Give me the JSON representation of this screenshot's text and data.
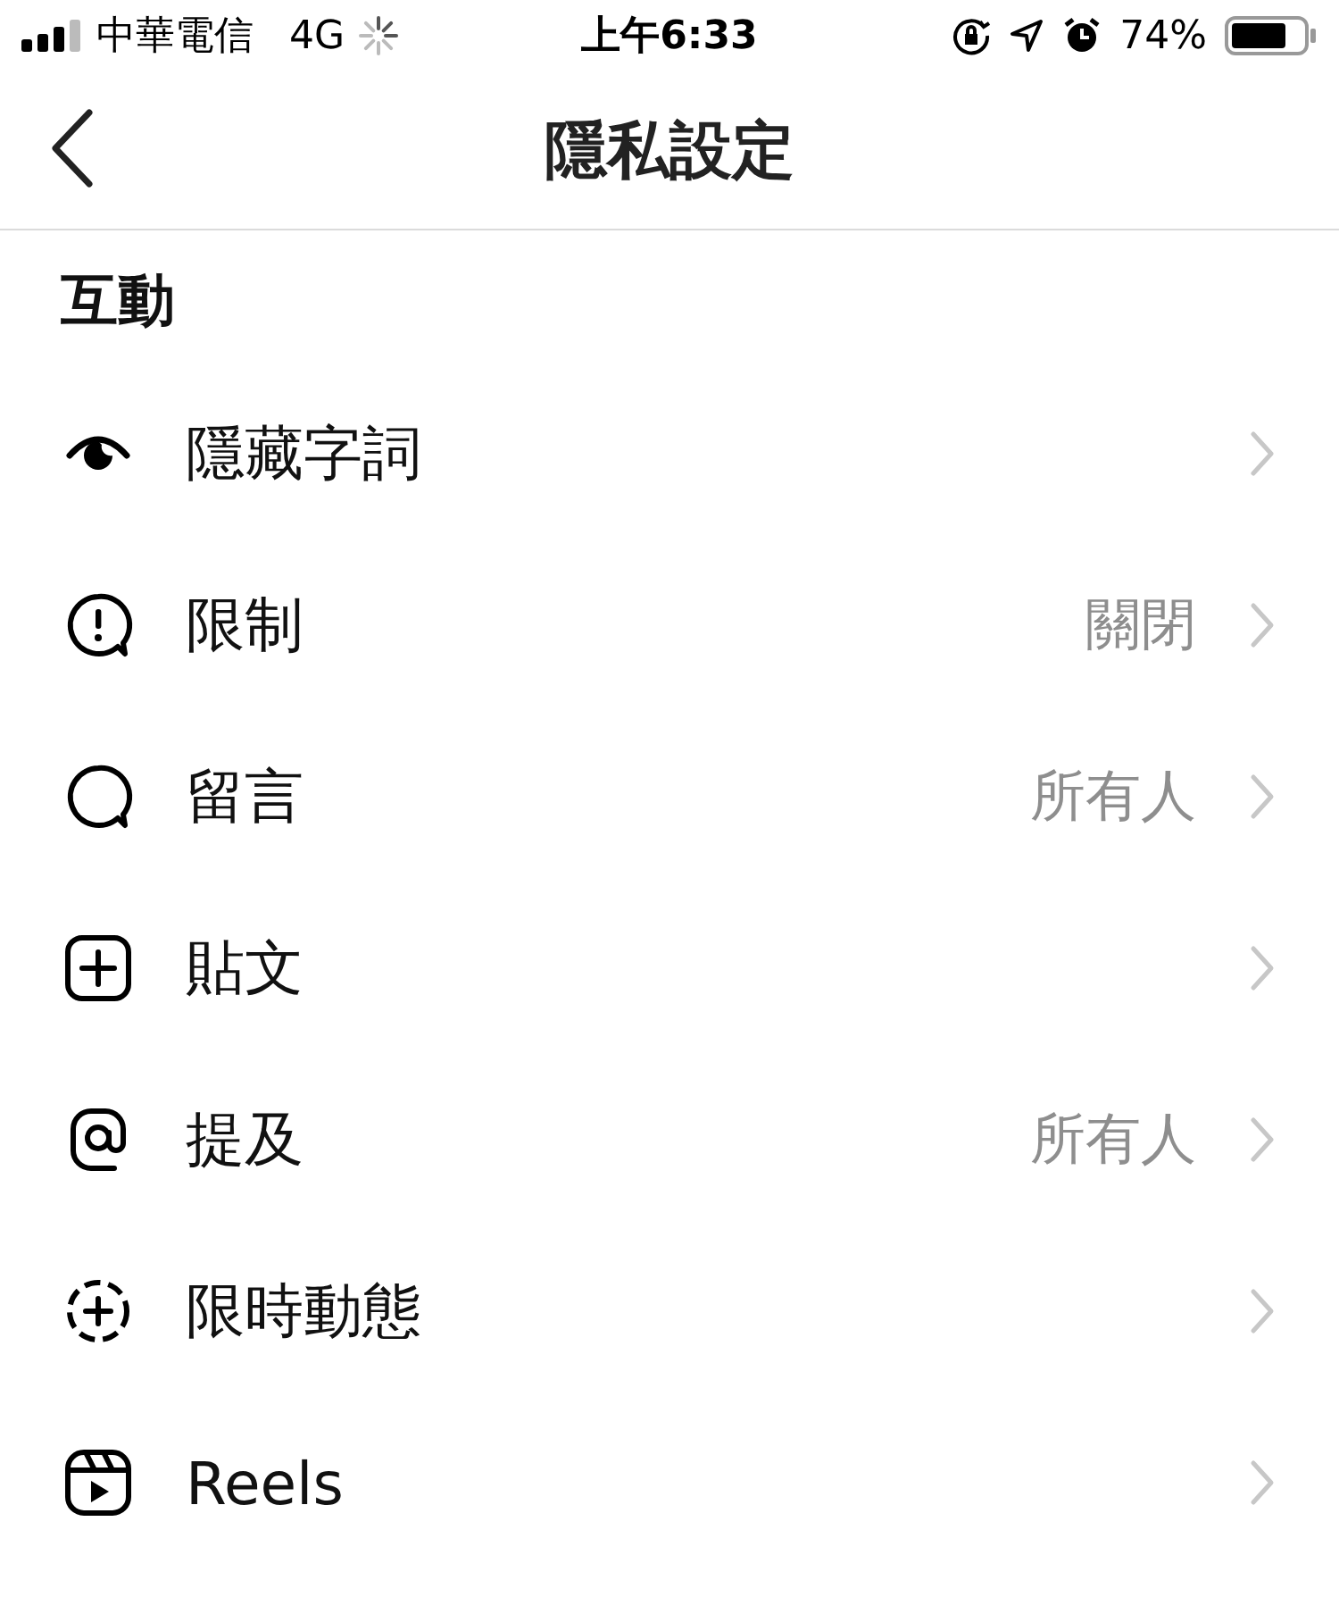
{
  "status_bar": {
    "carrier": "中華電信",
    "network": "4G",
    "time": "上午6:33",
    "battery": "74%"
  },
  "nav": {
    "title": "隱私設定"
  },
  "section": {
    "title": "互動"
  },
  "items": [
    {
      "label": "隱藏字詞"
    },
    {
      "label": "限制",
      "value": "關閉"
    },
    {
      "label": "留言",
      "value": "所有人"
    },
    {
      "label": "貼文"
    },
    {
      "label": "提及",
      "value": "所有人"
    },
    {
      "label": "限時動態"
    },
    {
      "label": "Reels"
    }
  ]
}
